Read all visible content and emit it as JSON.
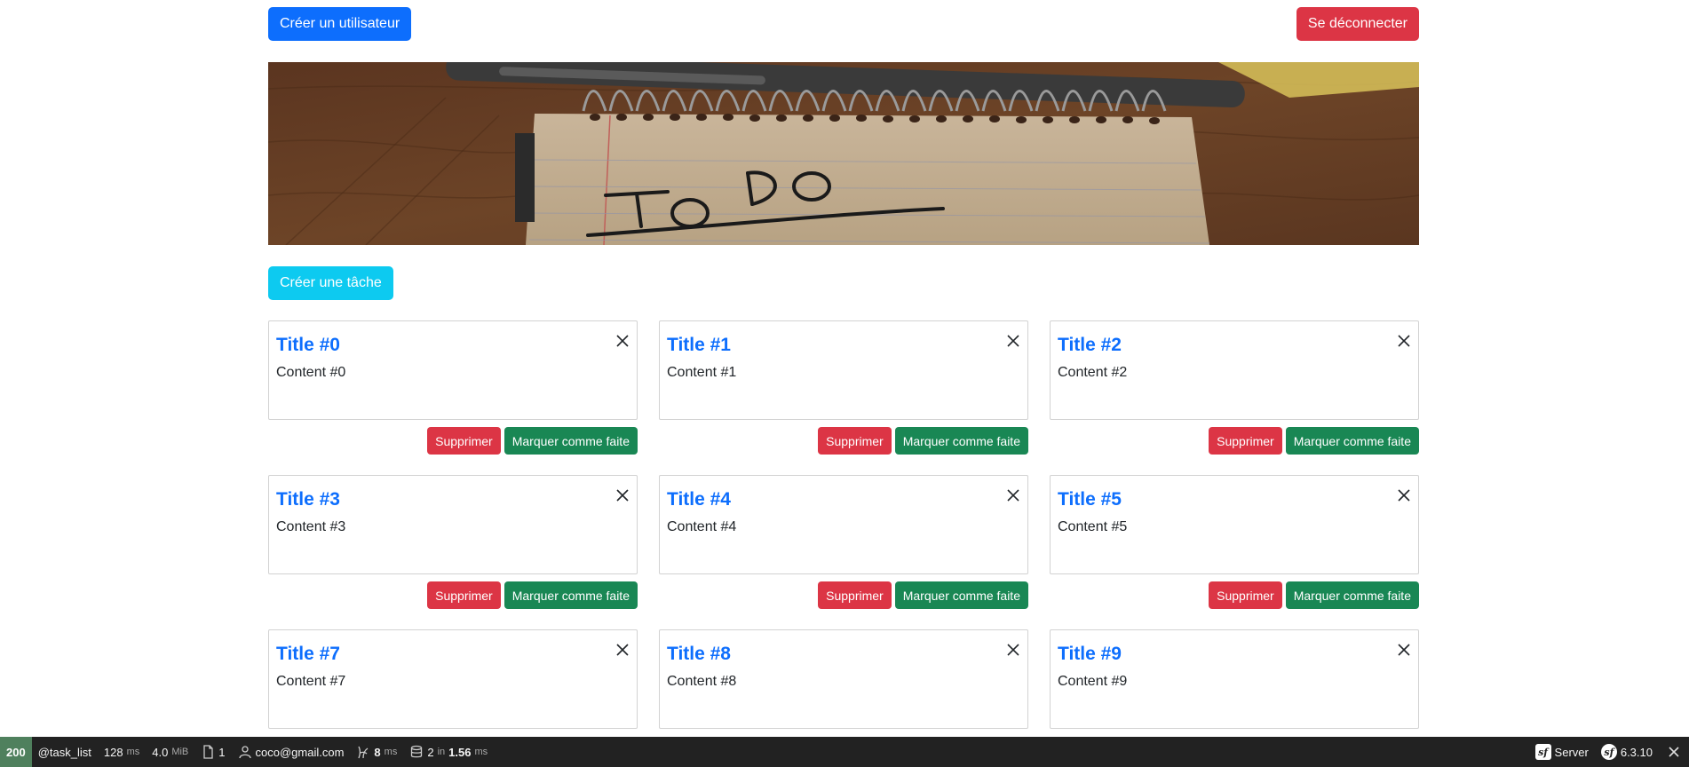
{
  "header": {
    "create_user_label": "Créer un utilisateur",
    "logout_label": "Se déconnecter"
  },
  "hero": {
    "alt": "To Do list image"
  },
  "create_task_label": "Créer une tâche",
  "tasks": [
    {
      "title": "Title #0",
      "content": "Content #0"
    },
    {
      "title": "Title #1",
      "content": "Content #1"
    },
    {
      "title": "Title #2",
      "content": "Content #2"
    },
    {
      "title": "Title #3",
      "content": "Content #3"
    },
    {
      "title": "Title #4",
      "content": "Content #4"
    },
    {
      "title": "Title #5",
      "content": "Content #5"
    },
    {
      "title": "Title #7",
      "content": "Content #7"
    },
    {
      "title": "Title #8",
      "content": "Content #8"
    },
    {
      "title": "Title #9",
      "content": "Content #9"
    }
  ],
  "task_actions": {
    "delete_label": "Supprimer",
    "mark_done_label": "Marquer comme faite"
  },
  "toolbar": {
    "status_code": "200",
    "route": "@task_list",
    "time_value": "128",
    "time_unit": "ms",
    "memory_value": "4.0",
    "memory_unit": "MiB",
    "forms_count": "1",
    "user": "coco@gmail.com",
    "twig_value": "8",
    "twig_unit": "ms",
    "db_queries": "2",
    "db_in": "in",
    "db_time": "1.56",
    "db_unit": "ms",
    "server_label": "Server",
    "version": "6.3.10"
  },
  "colors": {
    "primary": "#0d6efd",
    "danger": "#dc3545",
    "info": "#0dcaf0",
    "success": "#198754",
    "toolbar_bg": "#222222",
    "status_green": "#4f805d"
  }
}
